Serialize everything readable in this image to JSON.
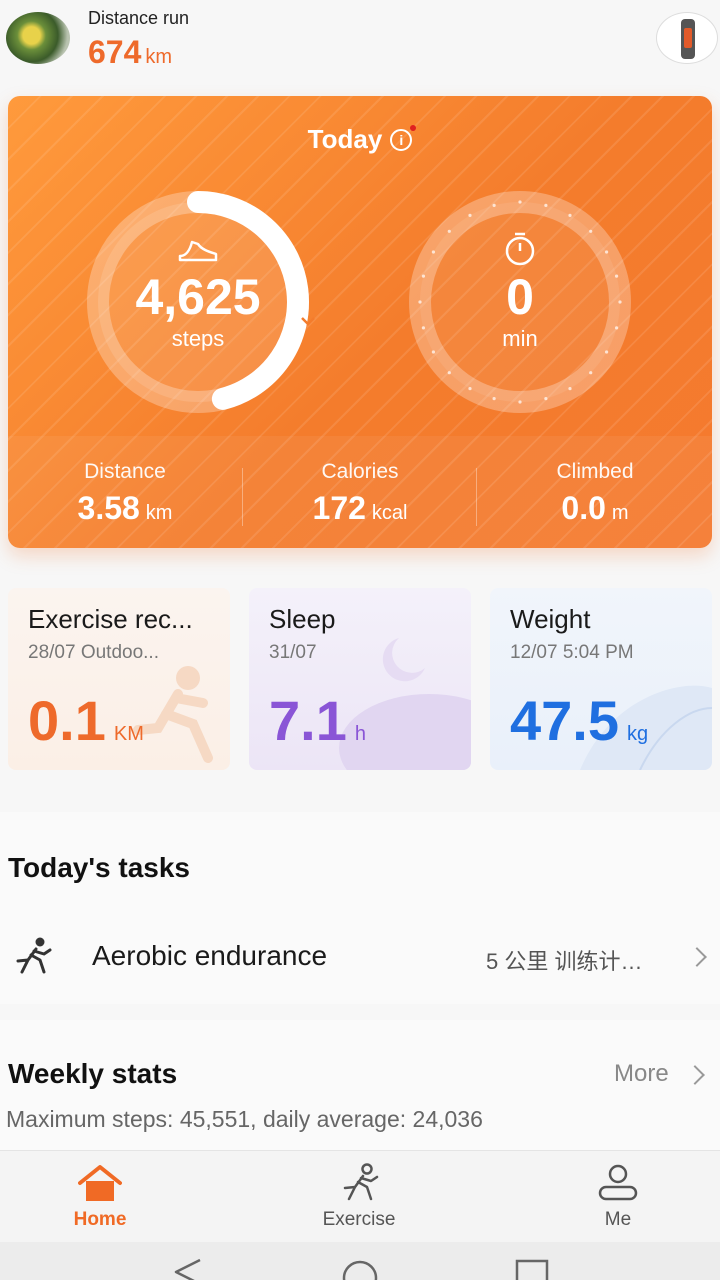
{
  "header": {
    "distance_label": "Distance run",
    "distance_value": "674",
    "distance_unit": "km"
  },
  "today": {
    "title": "Today",
    "info_icon": "i",
    "steps_value": "4,625",
    "steps_label": "steps",
    "steps_progress": 0.46,
    "active_value": "0",
    "active_label": "min",
    "stats": [
      {
        "label": "Distance",
        "value": "3.58",
        "unit": "km"
      },
      {
        "label": "Calories",
        "value": "172",
        "unit": "kcal"
      },
      {
        "label": "Climbed",
        "value": "0.0",
        "unit": "m"
      }
    ]
  },
  "cards": {
    "exercise": {
      "title": "Exercise rec...",
      "subtitle": "28/07 Outdoo...",
      "value": "0.1",
      "unit": "KM",
      "color": "#ee6a2b"
    },
    "sleep": {
      "title": "Sleep",
      "subtitle": "31/07",
      "value": "7.1",
      "unit": "h",
      "color": "#8a55d6"
    },
    "weight": {
      "title": "Weight",
      "subtitle": "12/07 5:04 PM",
      "value": "47.5",
      "unit": "kg",
      "color": "#1f6fe0"
    }
  },
  "tasks": {
    "title": "Today's tasks",
    "items": [
      {
        "label": "Aerobic endurance",
        "plan": "5 公里 训练计…"
      }
    ]
  },
  "weekly": {
    "title": "Weekly stats",
    "more": "More",
    "description": "Maximum steps: 45,551, daily average: 24,036"
  },
  "nav": {
    "home": "Home",
    "exercise": "Exercise",
    "me": "Me",
    "active_color": "#f06a25"
  }
}
